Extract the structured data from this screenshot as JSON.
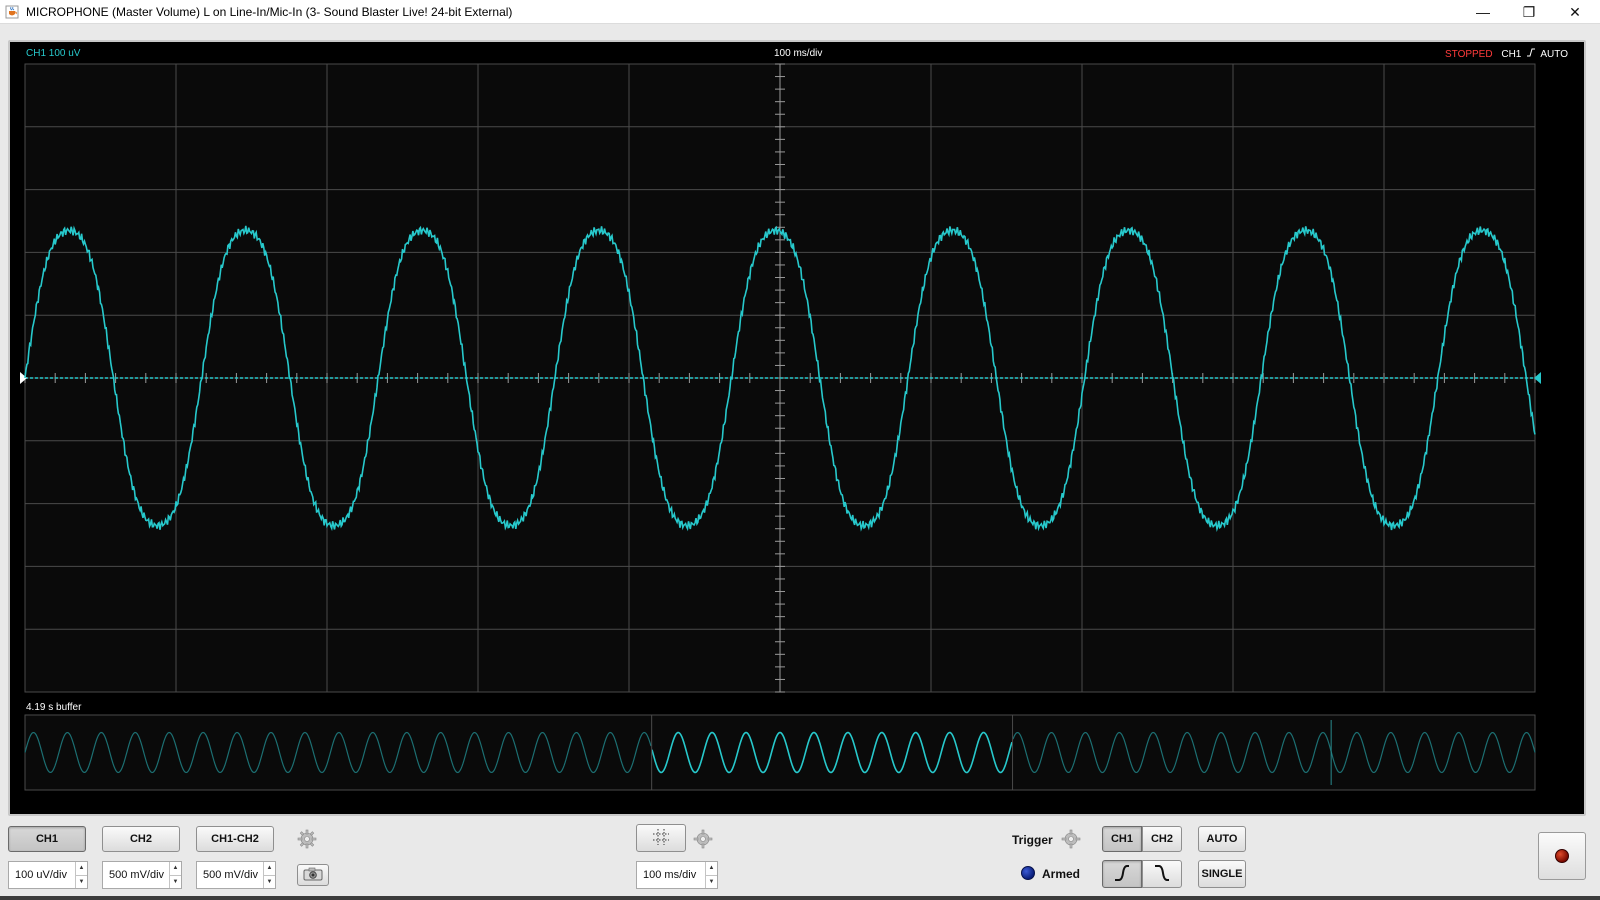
{
  "window": {
    "title": "MICROPHONE (Master Volume) L on Line-In/Mic-In (3- Sound Blaster Live! 24-bit External)",
    "app_icon": "java-cup-icon",
    "minimize_glyph": "—",
    "restore_glyph": "❐",
    "close_glyph": "✕"
  },
  "scope": {
    "channel_label": "CH1 100 uV",
    "timebase_label": "100 ms/div",
    "status": "STOPPED",
    "trigger_channel": "CH1",
    "trigger_mode": "AUTO",
    "buffer_label": "4.19 s buffer",
    "trace_color": "#27c9cc",
    "status_color": "#ff3b3b",
    "grid_color": "#4a4a4a",
    "waveform_divisions": 10,
    "waveform_cycles": 8.55,
    "waveform_amplitude_div": 2.5,
    "buffer_cycles": 44.5,
    "buffer_window_fraction": [
      0.415,
      0.654
    ]
  },
  "controls": {
    "ch1_label": "CH1",
    "ch2_label": "CH2",
    "diff_label": "CH1-CH2",
    "ch1_scale": "100 uV/div",
    "ch2_scale": "500 mV/div",
    "diff_scale": "500 mV/div",
    "timebase_scale": "100 ms/div",
    "trigger_label": "Trigger",
    "trigger_ch1": "CH1",
    "trigger_ch2": "CH2",
    "auto_label": "AUTO",
    "single_label": "SINGLE",
    "armed_label": "Armed",
    "armed_color": "#0a1e7a"
  }
}
